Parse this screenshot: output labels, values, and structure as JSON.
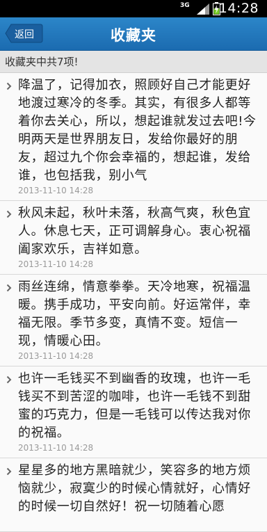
{
  "status_bar": {
    "network": "3G",
    "time": "14:28"
  },
  "header": {
    "back_label": "返回",
    "title": "收藏夹"
  },
  "count_text": "收藏夹中共7项!",
  "items": [
    {
      "text": "降温了，记得加衣，照顾好自己才能更好地渡过寒冷的冬季。其实，有很多人都等着你去关心，所以，想起谁就发过去吧!今明两天是世界朋友日，发给你最好的朋友，超过九个你会幸福的，想起谁，发给谁，也包括我，别小气",
      "time": "2013-11-10 14:28"
    },
    {
      "text": "秋风未起，秋叶未落，秋高气爽，秋色宜人。休息七天，正可调解身心。衷心祝福阖家欢乐，吉祥如意。",
      "time": "2013-11-10 14:28"
    },
    {
      "text": "雨丝连绵，情意拳拳。天冷地寒，祝福温暖。携手成功，平安向前。好运常伴，幸福无限。季节多变，真情不变。短信一现，情暖心田。",
      "time": "2013-11-10 14:28"
    },
    {
      "text": "也许一毛钱买不到幽香的玫瑰，也许一毛钱买不到苦涩的咖啡，也许一毛钱不到甜蜜的巧克力，但是一毛钱可以传达我对你的祝福。",
      "time": "2013-11-10 14:28"
    },
    {
      "text": "星星多的地方黑暗就少，笑容多的地方烦恼就少，寂寞少的时候心情就好，心情好的时候一切自然好！祝一切随着心愿",
      "time": ""
    }
  ]
}
